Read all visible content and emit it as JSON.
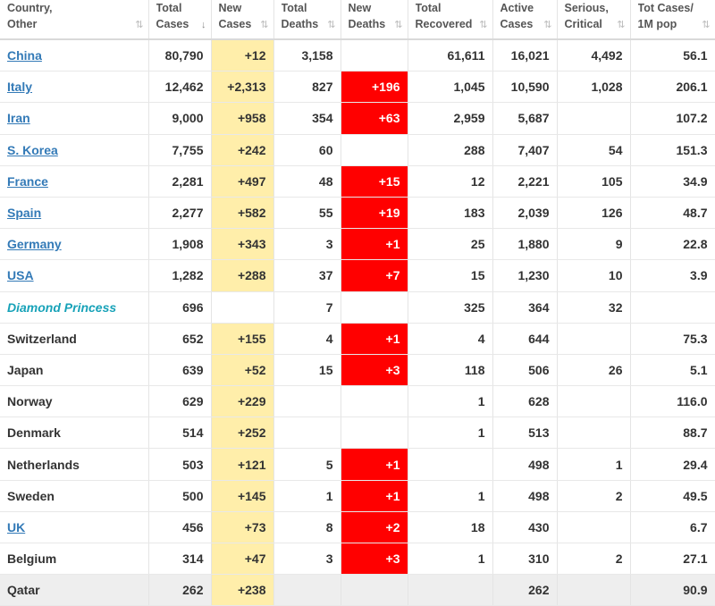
{
  "headers": [
    {
      "l1": "Country,",
      "l2": "Other",
      "sort": "⇅",
      "active": false
    },
    {
      "l1": "Total",
      "l2": "Cases",
      "sort": "↓",
      "active": true
    },
    {
      "l1": "New",
      "l2": "Cases",
      "sort": "⇅",
      "active": false
    },
    {
      "l1": "Total",
      "l2": "Deaths",
      "sort": "⇅",
      "active": false
    },
    {
      "l1": "New",
      "l2": "Deaths",
      "sort": "⇅",
      "active": false
    },
    {
      "l1": "Total",
      "l2": "Recovered",
      "sort": "⇅",
      "active": false
    },
    {
      "l1": "Active",
      "l2": "Cases",
      "sort": "⇅",
      "active": false
    },
    {
      "l1": "Serious,",
      "l2": "Critical",
      "sort": "⇅",
      "active": false
    },
    {
      "l1": "Tot Cases/",
      "l2": "1M pop",
      "sort": "⇅",
      "active": false
    }
  ],
  "rows": [
    {
      "country": "China",
      "link": true,
      "total": "80,790",
      "new": "+12",
      "deaths": "3,158",
      "new_deaths": "",
      "recovered": "61,611",
      "active": "16,021",
      "serious": "4,492",
      "per_m": "56.1"
    },
    {
      "country": "Italy",
      "link": true,
      "total": "12,462",
      "new": "+2,313",
      "deaths": "827",
      "new_deaths": "+196",
      "recovered": "1,045",
      "active": "10,590",
      "serious": "1,028",
      "per_m": "206.1"
    },
    {
      "country": "Iran",
      "link": true,
      "total": "9,000",
      "new": "+958",
      "deaths": "354",
      "new_deaths": "+63",
      "recovered": "2,959",
      "active": "5,687",
      "serious": "",
      "per_m": "107.2"
    },
    {
      "country": "S. Korea",
      "link": true,
      "total": "7,755",
      "new": "+242",
      "deaths": "60",
      "new_deaths": "",
      "recovered": "288",
      "active": "7,407",
      "serious": "54",
      "per_m": "151.3"
    },
    {
      "country": "France",
      "link": true,
      "total": "2,281",
      "new": "+497",
      "deaths": "48",
      "new_deaths": "+15",
      "recovered": "12",
      "active": "2,221",
      "serious": "105",
      "per_m": "34.9"
    },
    {
      "country": "Spain",
      "link": true,
      "total": "2,277",
      "new": "+582",
      "deaths": "55",
      "new_deaths": "+19",
      "recovered": "183",
      "active": "2,039",
      "serious": "126",
      "per_m": "48.7"
    },
    {
      "country": "Germany",
      "link": true,
      "total": "1,908",
      "new": "+343",
      "deaths": "3",
      "new_deaths": "+1",
      "recovered": "25",
      "active": "1,880",
      "serious": "9",
      "per_m": "22.8"
    },
    {
      "country": "USA",
      "link": true,
      "total": "1,282",
      "new": "+288",
      "deaths": "37",
      "new_deaths": "+7",
      "recovered": "15",
      "active": "1,230",
      "serious": "10",
      "per_m": "3.9"
    },
    {
      "country": "Diamond Princess",
      "ship": true,
      "total": "696",
      "new": "",
      "deaths": "7",
      "new_deaths": "",
      "recovered": "325",
      "active": "364",
      "serious": "32",
      "per_m": ""
    },
    {
      "country": "Switzerland",
      "total": "652",
      "new": "+155",
      "deaths": "4",
      "new_deaths": "+1",
      "recovered": "4",
      "active": "644",
      "serious": "",
      "per_m": "75.3"
    },
    {
      "country": "Japan",
      "total": "639",
      "new": "+52",
      "deaths": "15",
      "new_deaths": "+3",
      "recovered": "118",
      "active": "506",
      "serious": "26",
      "per_m": "5.1"
    },
    {
      "country": "Norway",
      "total": "629",
      "new": "+229",
      "deaths": "",
      "new_deaths": "",
      "recovered": "1",
      "active": "628",
      "serious": "",
      "per_m": "116.0"
    },
    {
      "country": "Denmark",
      "total": "514",
      "new": "+252",
      "deaths": "",
      "new_deaths": "",
      "recovered": "1",
      "active": "513",
      "serious": "",
      "per_m": "88.7"
    },
    {
      "country": "Netherlands",
      "total": "503",
      "new": "+121",
      "deaths": "5",
      "new_deaths": "+1",
      "recovered": "",
      "active": "498",
      "serious": "1",
      "per_m": "29.4"
    },
    {
      "country": "Sweden",
      "total": "500",
      "new": "+145",
      "deaths": "1",
      "new_deaths": "+1",
      "recovered": "1",
      "active": "498",
      "serious": "2",
      "per_m": "49.5"
    },
    {
      "country": "UK",
      "link": true,
      "total": "456",
      "new": "+73",
      "deaths": "8",
      "new_deaths": "+2",
      "recovered": "18",
      "active": "430",
      "serious": "",
      "per_m": "6.7"
    },
    {
      "country": "Belgium",
      "total": "314",
      "new": "+47",
      "deaths": "3",
      "new_deaths": "+3",
      "recovered": "1",
      "active": "310",
      "serious": "2",
      "per_m": "27.1"
    },
    {
      "country": "Qatar",
      "total": "262",
      "new": "+238",
      "deaths": "",
      "new_deaths": "",
      "recovered": "",
      "active": "262",
      "serious": "",
      "per_m": "90.9"
    }
  ],
  "colors": {
    "new_cases_bg": "#ffeeaa",
    "new_deaths_bg": "#ff0000",
    "link": "#337ab7",
    "ship": "#17a2b8"
  }
}
